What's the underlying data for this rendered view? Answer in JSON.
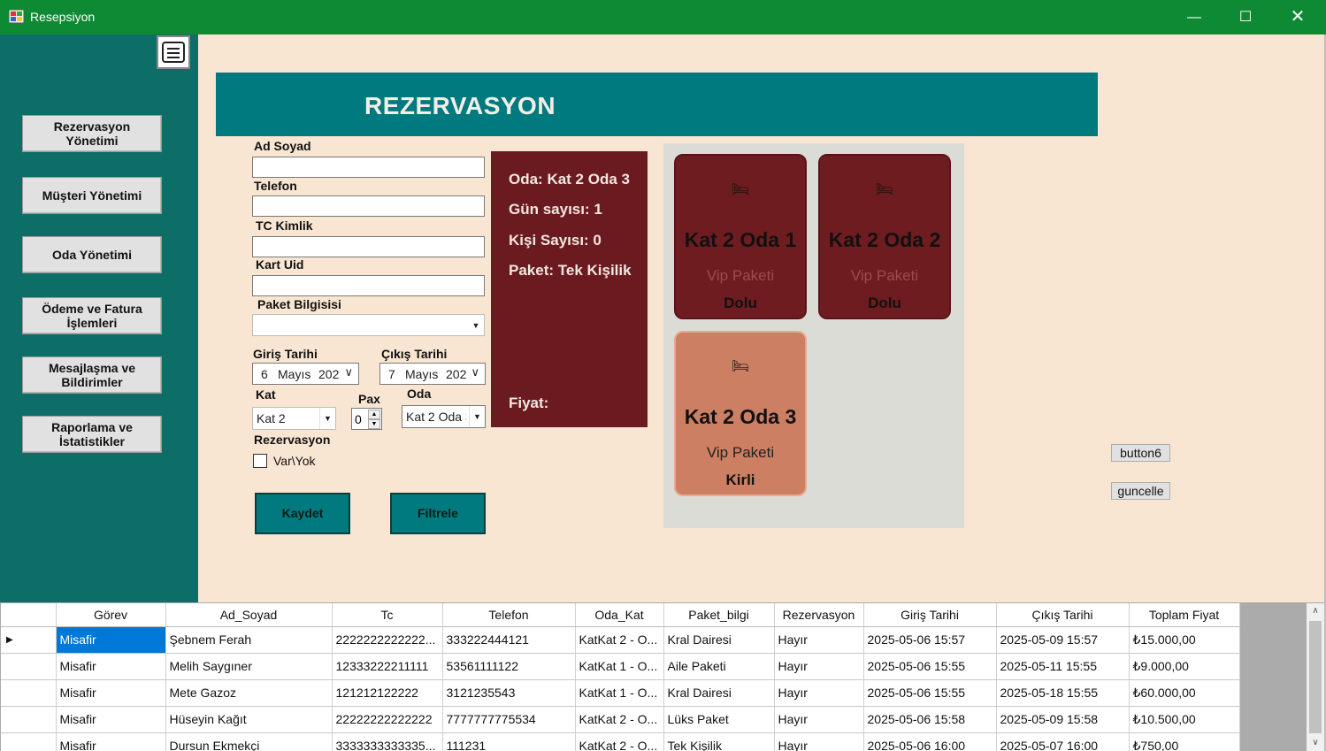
{
  "window": {
    "title": "Resepsiyon"
  },
  "sidebar": {
    "items": [
      {
        "label1": "Rezervasyon",
        "label2": "Yönetimi"
      },
      {
        "label1": "Müşteri Yönetimi",
        "label2": ""
      },
      {
        "label1": "Oda Yönetimi",
        "label2": ""
      },
      {
        "label1": "Ödeme ve Fatura",
        "label2": "İşlemleri"
      },
      {
        "label1": "Mesajlaşma ve",
        "label2": "Bildirimler"
      },
      {
        "label1": "Raporlama ve",
        "label2": "İstatistikler"
      }
    ]
  },
  "header": {
    "title": "REZERVASYON"
  },
  "form": {
    "ad_soyad_label": "Ad Soyad",
    "telefon_label": "Telefon",
    "tc_label": "TC Kimlik",
    "kart_label": "Kart Uid",
    "paket_label": "Paket Bilgisisi",
    "giris_label": "Giriş Tarihi",
    "cikis_label": "Çıkış Tarihi",
    "giris_day": "6",
    "giris_month": "Mayıs",
    "giris_year": "202",
    "cikis_day": "7",
    "cikis_month": "Mayıs",
    "cikis_year": "202",
    "kat_label": "Kat",
    "kat_value": "Kat 2",
    "pax_label": "Pax",
    "pax_value": "0",
    "oda_label": "Oda",
    "oda_value": "Kat 2 Oda 3",
    "rez_label": "Rezervasyon",
    "rez_checkbox_label": "Var\\Yok",
    "save_label": "Kaydet",
    "filter_label": "Filtrele"
  },
  "info": {
    "oda": "Oda: Kat 2 Oda 3",
    "gun": "Gün sayısı: 1",
    "kisi": "Kişi Sayısı: 0",
    "paket": "Paket: Tek Kişilik",
    "fiyat": "Fiyat:"
  },
  "rooms": [
    {
      "name": "Kat 2 Oda 1",
      "package": "Vip Paketi",
      "status": "Dolu",
      "color": "#6e1c1f"
    },
    {
      "name": "Kat 2 Oda 2",
      "package": "Vip Paketi",
      "status": "Dolu",
      "color": "#6e1c1f"
    },
    {
      "name": "Kat 2 Oda 3",
      "package": "Vip Paketi",
      "status": "Kirli",
      "color": "#cc7f63"
    }
  ],
  "buttons": {
    "button6": "button6",
    "guncelle": "guncelle"
  },
  "table": {
    "columns": [
      "Görev",
      "Ad_Soyad",
      "Tc",
      "Telefon",
      "Oda_Kat",
      "Paket_bilgi",
      "Rezervasyon",
      "Giriş Tarihi",
      "Çıkış Tarihi",
      "Toplam Fiyat"
    ],
    "rows": [
      [
        "Misafir",
        "Şebnem Ferah",
        "2222222222222...",
        "333222444121",
        "KatKat 2 - O...",
        "Kral Dairesi",
        "Hayır",
        "2025-05-06 15:57",
        "2025-05-09 15:57",
        "₺15.000,00"
      ],
      [
        "Misafir",
        "Melih Saygıner",
        "12333222211111",
        "53561111122",
        "KatKat 1 - O...",
        "Aile Paketi",
        "Hayır",
        "2025-05-06 15:55",
        "2025-05-11 15:55",
        "₺9.000,00"
      ],
      [
        "Misafir",
        "Mete Gazoz",
        "121212122222",
        "3121235543",
        "KatKat 1 - O...",
        "Kral Dairesi",
        "Hayır",
        "2025-05-06 15:55",
        "2025-05-18 15:55",
        "₺60.000,00"
      ],
      [
        "Misafir",
        "Hüseyin Kağıt",
        "22222222222222",
        "7777777775534",
        "KatKat 2 - O...",
        "Lüks Paket",
        "Hayır",
        "2025-05-06 15:58",
        "2025-05-09 15:58",
        "₺10.500,00"
      ],
      [
        "Misafir",
        "Dursun Ekmekçi",
        "3333333333335...",
        "111231",
        "KatKat 2 - O...",
        "Tek Kişilik",
        "Hayır",
        "2025-05-06 16:00",
        "2025-05-07 16:00",
        "₺750,00"
      ]
    ]
  }
}
